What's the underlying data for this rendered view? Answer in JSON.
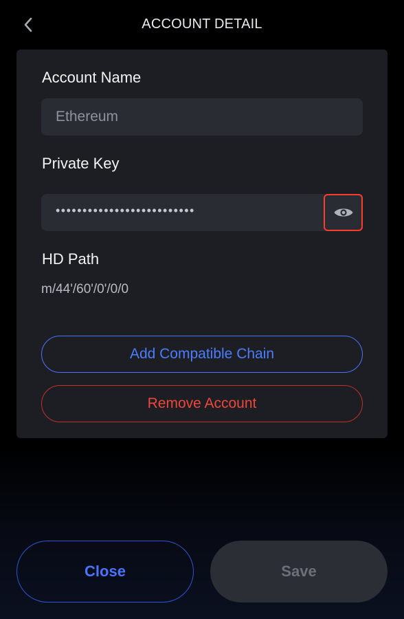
{
  "header": {
    "title": "ACCOUNT DETAIL",
    "back_icon": "chevron-left-icon"
  },
  "account": {
    "name_label": "Account Name",
    "name_placeholder": "Ethereum",
    "private_key_label": "Private Key",
    "private_key_masked": "••••••••••••••••••••••••••",
    "reveal_icon": "eye-icon",
    "hd_path_label": "HD Path",
    "hd_path_value": "m/44'/60'/0'/0/0"
  },
  "actions": {
    "add_chain_label": "Add Compatible Chain",
    "remove_account_label": "Remove Account"
  },
  "footer": {
    "close_label": "Close",
    "save_label": "Save"
  },
  "colors": {
    "accent_blue": "#4a74ff",
    "danger_red": "#f0463c",
    "highlight_red": "#ff3b30",
    "card_bg": "#1d1e23",
    "field_bg": "#2a2c33"
  }
}
